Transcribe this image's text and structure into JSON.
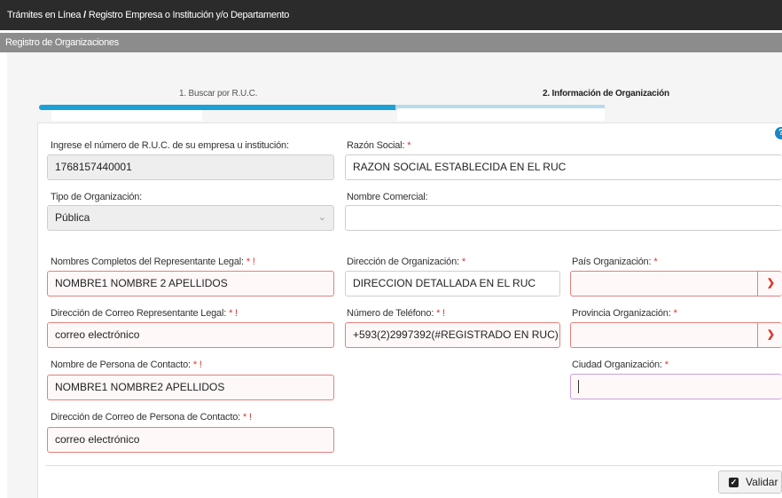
{
  "breadcrumb": {
    "part1": "Trámites en Línea",
    "separator": "/",
    "part2": "Registro Empresa o Institución y/o Departamento"
  },
  "section": {
    "title": "Registro de Organizaciones"
  },
  "wizard": {
    "step1": "1. Buscar por R.U.C.",
    "step2": "2. Información de Organización",
    "progress": 0.63
  },
  "form": {
    "ruc": {
      "label": "Ingrese el número de R.U.C. de su empresa u institución:",
      "value": "1768157440001"
    },
    "razon_social": {
      "label": "Razón Social:",
      "required": "*",
      "value": "RAZON SOCIAL ESTABLECIDA EN EL RUC"
    },
    "tipo_org": {
      "label": "Tipo de Organización:",
      "value": "Pública"
    },
    "nombre_comercial": {
      "label": "Nombre Comercial:",
      "value": ""
    },
    "representante": {
      "label": "Nombres Completos del Representante Legal:",
      "required": "* !",
      "value": "NOMBRE1 NOMBRE 2 APELLIDOS"
    },
    "direccion_org": {
      "label": "Dirección de Organización:",
      "required": "*",
      "value": "DIRECCION DETALLADA EN EL RUC"
    },
    "pais": {
      "label": "País Organización:",
      "required": "*",
      "value": ""
    },
    "correo_rep": {
      "label": "Dirección de Correo Representante Legal:",
      "required": "* !",
      "value": "correo electrónico"
    },
    "telefono": {
      "label": "Número de Teléfono:",
      "required": "* !",
      "value": "+593(2)2997392(#REGISTRADO EN RUC)"
    },
    "provincia": {
      "label": "Provincia Organización:",
      "required": "*",
      "value": ""
    },
    "contacto": {
      "label": "Nombre de Persona de Contacto:",
      "required": "* !",
      "value": "NOMBRE1 NOMBRE2 APELLIDOS"
    },
    "ciudad": {
      "label": "Ciudad Organización:",
      "required": "*",
      "value": ""
    },
    "correo_contacto": {
      "label": "Dirección de Correo de Persona de Contacto:",
      "required": "* !",
      "value": "correo electrónico"
    }
  },
  "actions": {
    "validar": "Validar"
  },
  "icons": {
    "help": "question-circle-icon",
    "select": "chevron-down-icon",
    "validar": "check-square-icon"
  },
  "colors": {
    "topbar": "#2b2b2b",
    "section_bar": "#8c8c8c",
    "progress": "#1ba1d5",
    "error_border": "#e3817c",
    "required": "#e0322e",
    "help": "#1a86c8"
  }
}
